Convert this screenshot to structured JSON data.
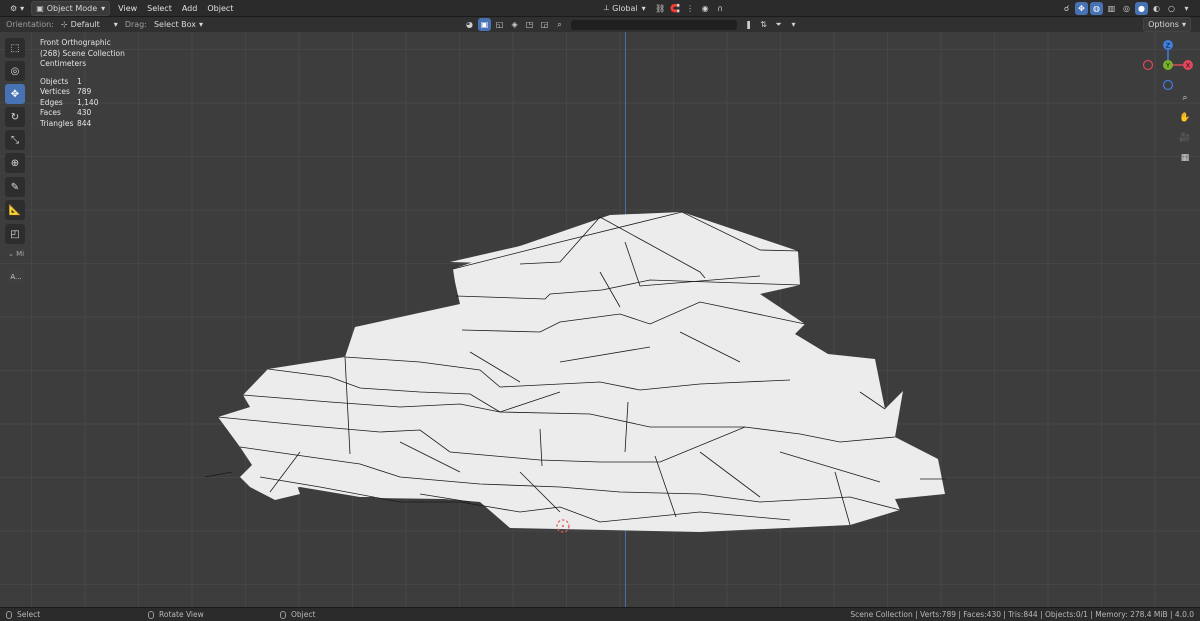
{
  "header": {
    "mode": "Object Mode",
    "menus": [
      "View",
      "Select",
      "Add",
      "Object"
    ],
    "transform_orientation": "Global",
    "options_label": "Options"
  },
  "tool_settings": {
    "orientation_label": "Orientation:",
    "orientation_value": "Default",
    "drag_label": "Drag:",
    "drag_value": "Select Box"
  },
  "viewport": {
    "view_name": "Front Orthographic",
    "collection": "(268) Scene Collection",
    "units": "Centimeters",
    "stats": [
      {
        "label": "Objects",
        "value": "1"
      },
      {
        "label": "Vertices",
        "value": "789"
      },
      {
        "label": "Edges",
        "value": "1,140"
      },
      {
        "label": "Faces",
        "value": "430"
      },
      {
        "label": "Triangles",
        "value": "844"
      }
    ],
    "side_panel_label": "Mi",
    "side_button_label": "A...",
    "gizmo": {
      "z": "Z",
      "y": "Y",
      "x": "X"
    }
  },
  "toolbar": {
    "tools": [
      "select-box",
      "cursor",
      "move",
      "rotate",
      "scale",
      "transform",
      "annotate",
      "measure",
      "add-cube"
    ]
  },
  "colors": {
    "accent": "#4772b3",
    "viewport_bg": "#3d3d3d",
    "mesh_fill": "#ececec",
    "axis_x": "#e0465a",
    "axis_y": "#7ab32a",
    "axis_z": "#3d7ee0"
  },
  "statusbar": {
    "select": "Select",
    "rotate_view": "Rotate View",
    "object": "Object",
    "info": "Scene Collection | Verts:789 | Faces:430 | Tris:844 | Objects:0/1 | Memory: 278.4 MiB | 4.0.0"
  }
}
